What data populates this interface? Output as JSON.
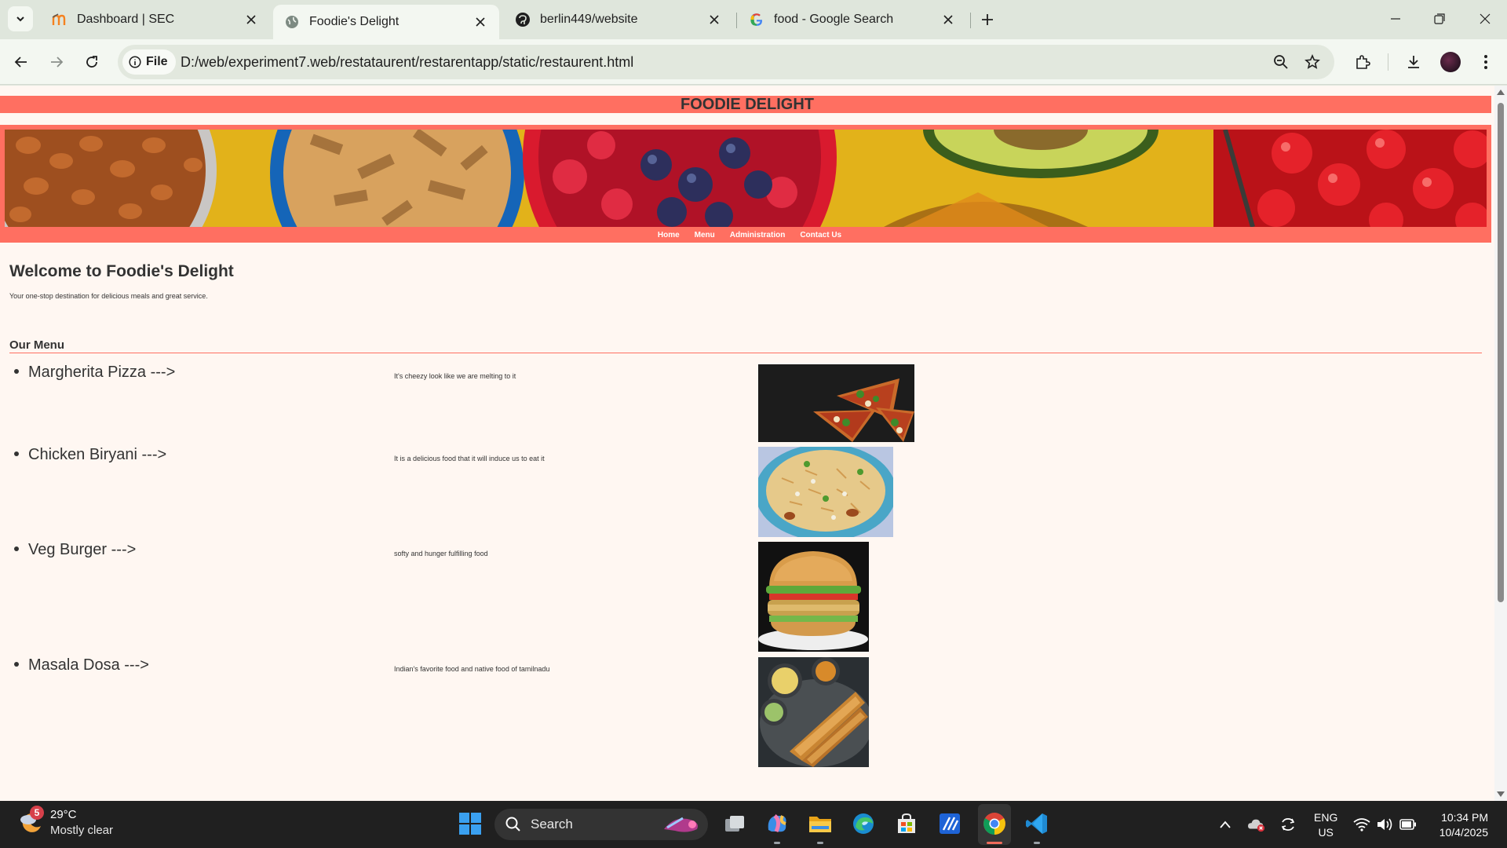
{
  "browser": {
    "tabs": [
      {
        "title": "Dashboard | SEC",
        "active": false,
        "icon": "moodle-icon"
      },
      {
        "title": "Foodie's Delight",
        "active": true,
        "icon": "globe-icon"
      },
      {
        "title": "berlin449/website",
        "active": false,
        "icon": "github-icon"
      },
      {
        "title": "food - Google Search",
        "active": false,
        "icon": "google-icon"
      }
    ],
    "site_chip": "File",
    "url": "D:/web/experiment7.web/restataurent/restarentapp/static/restaurent.html"
  },
  "page": {
    "site_title": "FOODIE DELIGHT",
    "nav": [
      "Home",
      "Menu",
      "Administration",
      "Contact Us"
    ],
    "welcome_heading": "Welcome to Foodie's Delight",
    "tagline": "Your one-stop destination for delicious meals and great service.",
    "menu_heading": "Our Menu",
    "menu_items": [
      {
        "name": "Margherita Pizza --->",
        "description": "It's cheezy look like we are melting to it",
        "image": "pizza-image"
      },
      {
        "name": "Chicken Biryani --->",
        "description": "It is a delicious food that it will induce us to eat it",
        "image": "biryani-image"
      },
      {
        "name": "Veg Burger --->",
        "description": "softy and hunger fulfilling food",
        "image": "burger-image"
      },
      {
        "name": "Masala Dosa --->",
        "description": "Indian's favorite food and native food of tamilnadu",
        "image": "dosa-image"
      }
    ]
  },
  "taskbar": {
    "weather_badge": "5",
    "temperature": "29°C",
    "weather_desc": "Mostly clear",
    "search_label": "Search",
    "lang_line1": "ENG",
    "lang_line2": "US",
    "time": "10:34 PM",
    "date": "10/4/2025"
  },
  "colors": {
    "accent": "#ff6f61",
    "page_bg": "#fff7f2",
    "text": "#333333"
  }
}
